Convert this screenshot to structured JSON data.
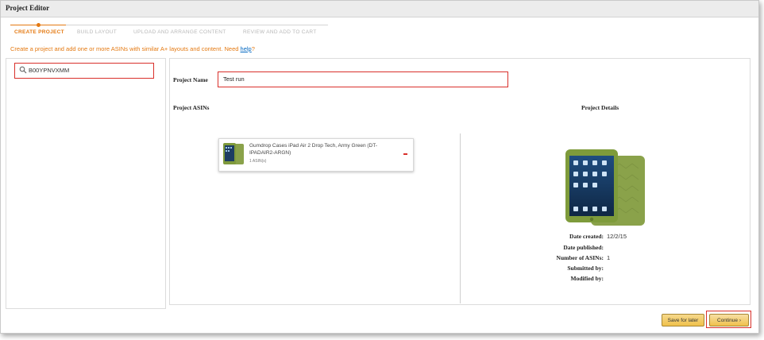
{
  "window": {
    "title": "Project Editor"
  },
  "steps": [
    {
      "label": "CREATE PROJECT",
      "active": true
    },
    {
      "label": "BUILD LAYOUT",
      "active": false
    },
    {
      "label": "UPLOAD AND ARRANGE CONTENT",
      "active": false
    },
    {
      "label": "REVIEW AND ADD TO CART",
      "active": false
    }
  ],
  "instructions": {
    "text": "Create a project and add one or more ASINs with similar A+ layouts and content. Need ",
    "link": "help",
    "suffix": "?"
  },
  "search": {
    "value": "B00YPNVXMM",
    "icon": "search-icon"
  },
  "project": {
    "name_label": "Project Name",
    "name_value": "Test run",
    "asins_label": "Project ASINs",
    "details_label": "Project Details"
  },
  "asin_card": {
    "title": "Gumdrop Cases iPad Air 2 Drop Tech, Army Green (DT-IPADAIR2-ARGN)",
    "count": "1 ASIN(s)"
  },
  "details": [
    {
      "key": "Date created:",
      "value": "12/2/15"
    },
    {
      "key": "Date published:",
      "value": ""
    },
    {
      "key": "Number of ASINs:",
      "value": "1"
    },
    {
      "key": "Submitted by:",
      "value": ""
    },
    {
      "key": "Modified by:",
      "value": ""
    }
  ],
  "actions": {
    "save_label": "Save for later",
    "continue_label": "Continue ›"
  },
  "colors": {
    "accent": "#e47911",
    "highlight": "#d9302b",
    "button": "#f0c14b",
    "product_green": "#8aa24a"
  }
}
